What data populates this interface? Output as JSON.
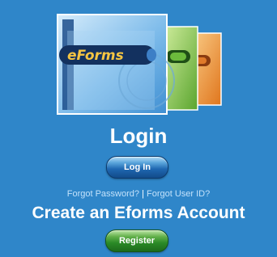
{
  "colors": {
    "page_background": "#2f86c9",
    "link": "#c3e2fb",
    "login_button": "#1f67b1",
    "register_button": "#2a8a26"
  },
  "logo": {
    "text": "eForms"
  },
  "login": {
    "title": "Login",
    "button_label": "Log In"
  },
  "forgot": {
    "password_label": "Forgot Password?",
    "separator": " | ",
    "user_id_label": "Forgot User ID?"
  },
  "create_account": {
    "title": "Create an Eforms Account",
    "button_label": "Register"
  }
}
